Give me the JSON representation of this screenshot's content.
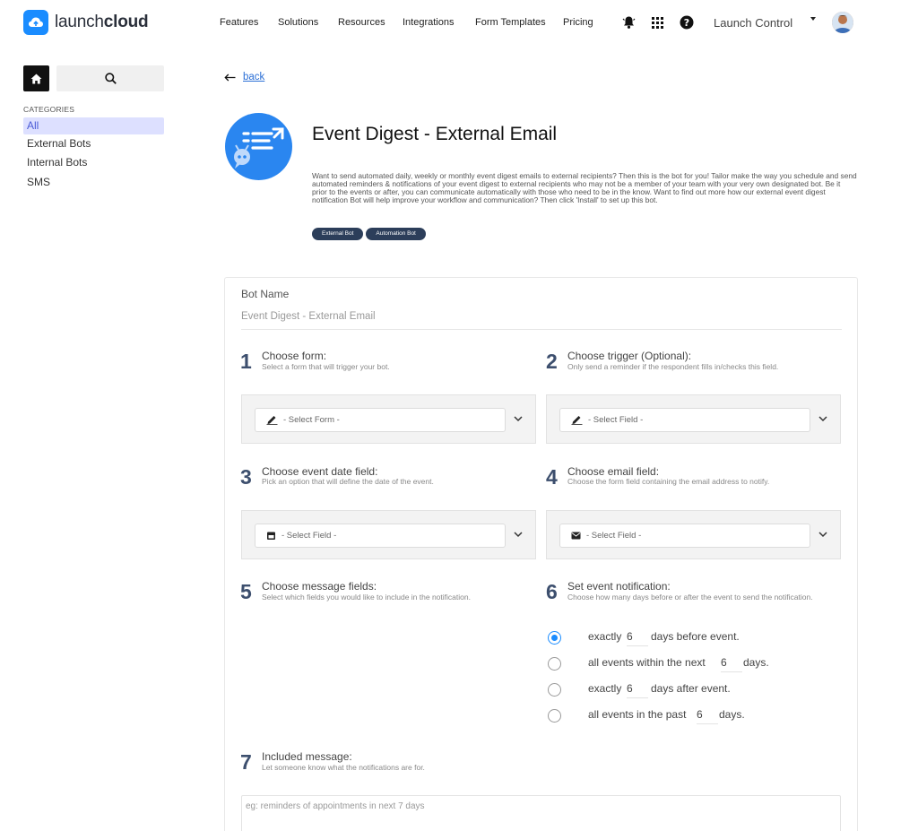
{
  "brand": {
    "logo_light": "launch",
    "logo_bold": "cloud",
    "accent": "#1a8cff"
  },
  "nav": {
    "items": [
      "Features",
      "Solutions",
      "Resources",
      "Integrations",
      "Form Templates",
      "Pricing"
    ],
    "icons": [
      "bell-icon",
      "apps-grid-icon",
      "help-icon"
    ],
    "account": "Launch Control"
  },
  "sidebar": {
    "heading": "CATEGORIES",
    "items": [
      "All",
      "External Bots",
      "Internal Bots",
      "SMS"
    ],
    "active": "All"
  },
  "header": {
    "back": "back",
    "title": "Event Digest - External Email",
    "description": "Want to send automated daily, weekly or monthly event digest emails to external recipients? Then this is the bot for you! Tailor make the way you schedule and send automated reminders & notifications of your event digest to external recipients who may not be a member of your team with your very own designated bot.  Be it prior to the events or after, you can communicate automatically with those who need to be in the know. Want to find out more how our external event digest notification Bot will help improve your workflow and communication? Then click 'Install' to set up this bot.",
    "tags": [
      "External Bot",
      "Automation Bot"
    ]
  },
  "form": {
    "bot_name_label": "Bot Name",
    "bot_name_value": "Event Digest - External Email",
    "steps": [
      {
        "num": "1",
        "title": "Choose form:",
        "sub": "Select a form that will trigger your bot.",
        "select": "- Select Form -",
        "icon": "pencil-icon"
      },
      {
        "num": "2",
        "title": "Choose trigger (Optional):",
        "sub": "Only send a reminder if the respondent fills in/checks this field.",
        "select": "- Select Field -",
        "icon": "pencil-icon"
      },
      {
        "num": "3",
        "title": "Choose event date field:",
        "sub": "Pick an option that will define the date of the event.",
        "select": "- Select Field -",
        "icon": "calendar-icon"
      },
      {
        "num": "4",
        "title": "Choose email field:",
        "sub": "Choose the form field containing the email address to notify.",
        "select": "- Select Field -",
        "icon": "envelope-icon"
      },
      {
        "num": "5",
        "title": "Choose message fields:",
        "sub": "Select which fields you would like to include in the notification."
      },
      {
        "num": "6",
        "title": "Set event notification:",
        "sub": "Choose how many days before or after the event to send the notification."
      },
      {
        "num": "7",
        "title": "Included message:",
        "sub": "Let someone know what the notifications are for."
      }
    ],
    "notification_options": [
      {
        "pre": "exactly",
        "value": "6",
        "post": "days before event.",
        "selected": true
      },
      {
        "pre": "all events within the next",
        "value": "6",
        "post": "days.",
        "selected": false
      },
      {
        "pre": "exactly",
        "value": "6",
        "post": "days after event.",
        "selected": false
      },
      {
        "pre": "all events in the past",
        "value": "6",
        "post": "days.",
        "selected": false
      }
    ],
    "message_placeholder": "eg: reminders of appointments in next 7 days"
  }
}
